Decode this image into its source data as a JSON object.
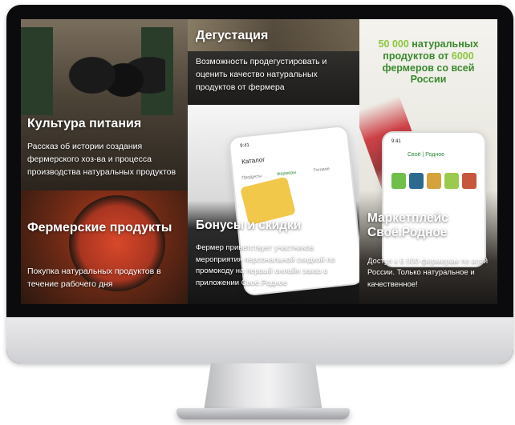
{
  "tiles": {
    "culture": {
      "title": "Культура питания",
      "text": "Рассказ об истории создания фермерского хоз-ва и процесса производства натуральных продуктов"
    },
    "tasting": {
      "title": "Дегустация",
      "text": "Возможность продегустировать и оценить качество натуральных продуктов от фермера"
    },
    "banner": {
      "promo_num1": "50 000",
      "promo_line1": "натуральных продуктов от",
      "promo_num2": "6000",
      "promo_line2": "фермеров со всей России",
      "title": "Маркетплейс Своё.Родное",
      "text": "Доступ к 6 000 фермерам по всей России. Только натуральное и качественное!"
    },
    "bonus": {
      "title": "Бонусы и скидки",
      "text": "Фермер приветствует участников мероприятия персональной скидкой по промокоду на первый онлайн заказ в приложении Своё.Родное"
    },
    "products": {
      "title": "Фермерские продукты",
      "text": "Покупка натуральных продуктов в течение рабочего дня"
    }
  },
  "phone_ui": {
    "time": "9:41",
    "catalog": "Каталог",
    "tab_products": "Продукты",
    "tab_farmers": "Фермеры",
    "tab_ready": "Готовое",
    "app_name": "Своё | Родное"
  },
  "colors": {
    "promo_green": "#3b8a2f",
    "promo_accent": "#8cc63f",
    "app_green": "#2f8a3a"
  }
}
